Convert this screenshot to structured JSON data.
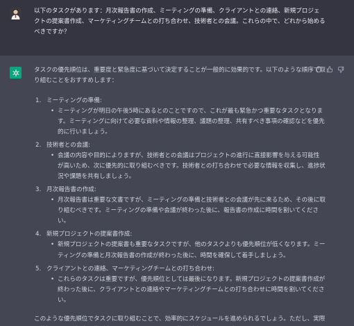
{
  "user": {
    "message": "以下のタスクがあります：月次報告書の作成、ミーティングの準備、クライアントとの連絡、新規プロジェクトの提案書作成、マーケティングチームとの打ち合わせ、技術者との会議。これらの中で、どれから始めるべきですか？"
  },
  "assistant": {
    "intro": "タスクの優先順位は、重要度と緊急度に基づいて決定することが一般的に効果的です。以下のような順序で取り組むことをおすすめします：",
    "items": [
      {
        "num": "1.",
        "title": "ミーティングの準備:",
        "detail": "ミーティングが明日の午後5時にあるとのことですので、これが最も緊急かつ重要なタスクとなります。ミーティングに向けて必要な資料や情報の整理、議題の整理、共有すべき事項の確認などを優先的に行いましょう。"
      },
      {
        "num": "2.",
        "title": "技術者との会議:",
        "detail": "会議の内容や目的によりますが、技術者との会議はプロジェクトの進行に直接影響を与える可能性が高いため、次に優先的に取り組むべきです。技術者との打ち合わせで必要な情報を収集し、進捗状況や課題を共有しましょう。"
      },
      {
        "num": "3.",
        "title": "月次報告書の作成:",
        "detail": "月次報告書は重要な文書ですが、ミーティングの準備と技術者との会議が先に来るため、その後に取り組むべきです。ミーティングの準備や会議が終わった後に、報告書の作成に時間を割いてください。"
      },
      {
        "num": "4.",
        "title": "新規プロジェクトの提案書作成:",
        "detail": "新規プロジェクトの提案書も重要なタスクですが、他のタスクよりも優先順位が低くなります。ミーティングの準備と月次報告書の作成が終わった後に、時間を確保して着手しましょう。"
      },
      {
        "num": "5.",
        "title": "クライアントとの連絡、マーケティングチームとの打ち合わせ:",
        "detail": "これらのタスクは重要ですが、優先順位としては最後になります。新規プロジェクトの提案書作成が終わった後に、クライアントとの連絡やマーケティングチームとの打ち合わせに時間を割いてください。"
      }
    ],
    "outro": "このような優先順位でタスクに取り組むことで、効率的にスケジュールを進められるでしょう。ただし、実際の状況によって優先順位が変わることもあるため、柔軟に対応することも大切です。"
  },
  "icons": {
    "user_avatar": "user-avatar",
    "assistant_avatar": "chatgpt-logo-icon",
    "copy": "clipboard-icon",
    "thumbs_up": "thumbs-up-icon",
    "thumbs_down": "thumbs-down-icon"
  },
  "colors": {
    "user_bg": "#343541",
    "assistant_bg": "#444654",
    "logo_green": "#10a37f",
    "text": "#d1d5db"
  }
}
